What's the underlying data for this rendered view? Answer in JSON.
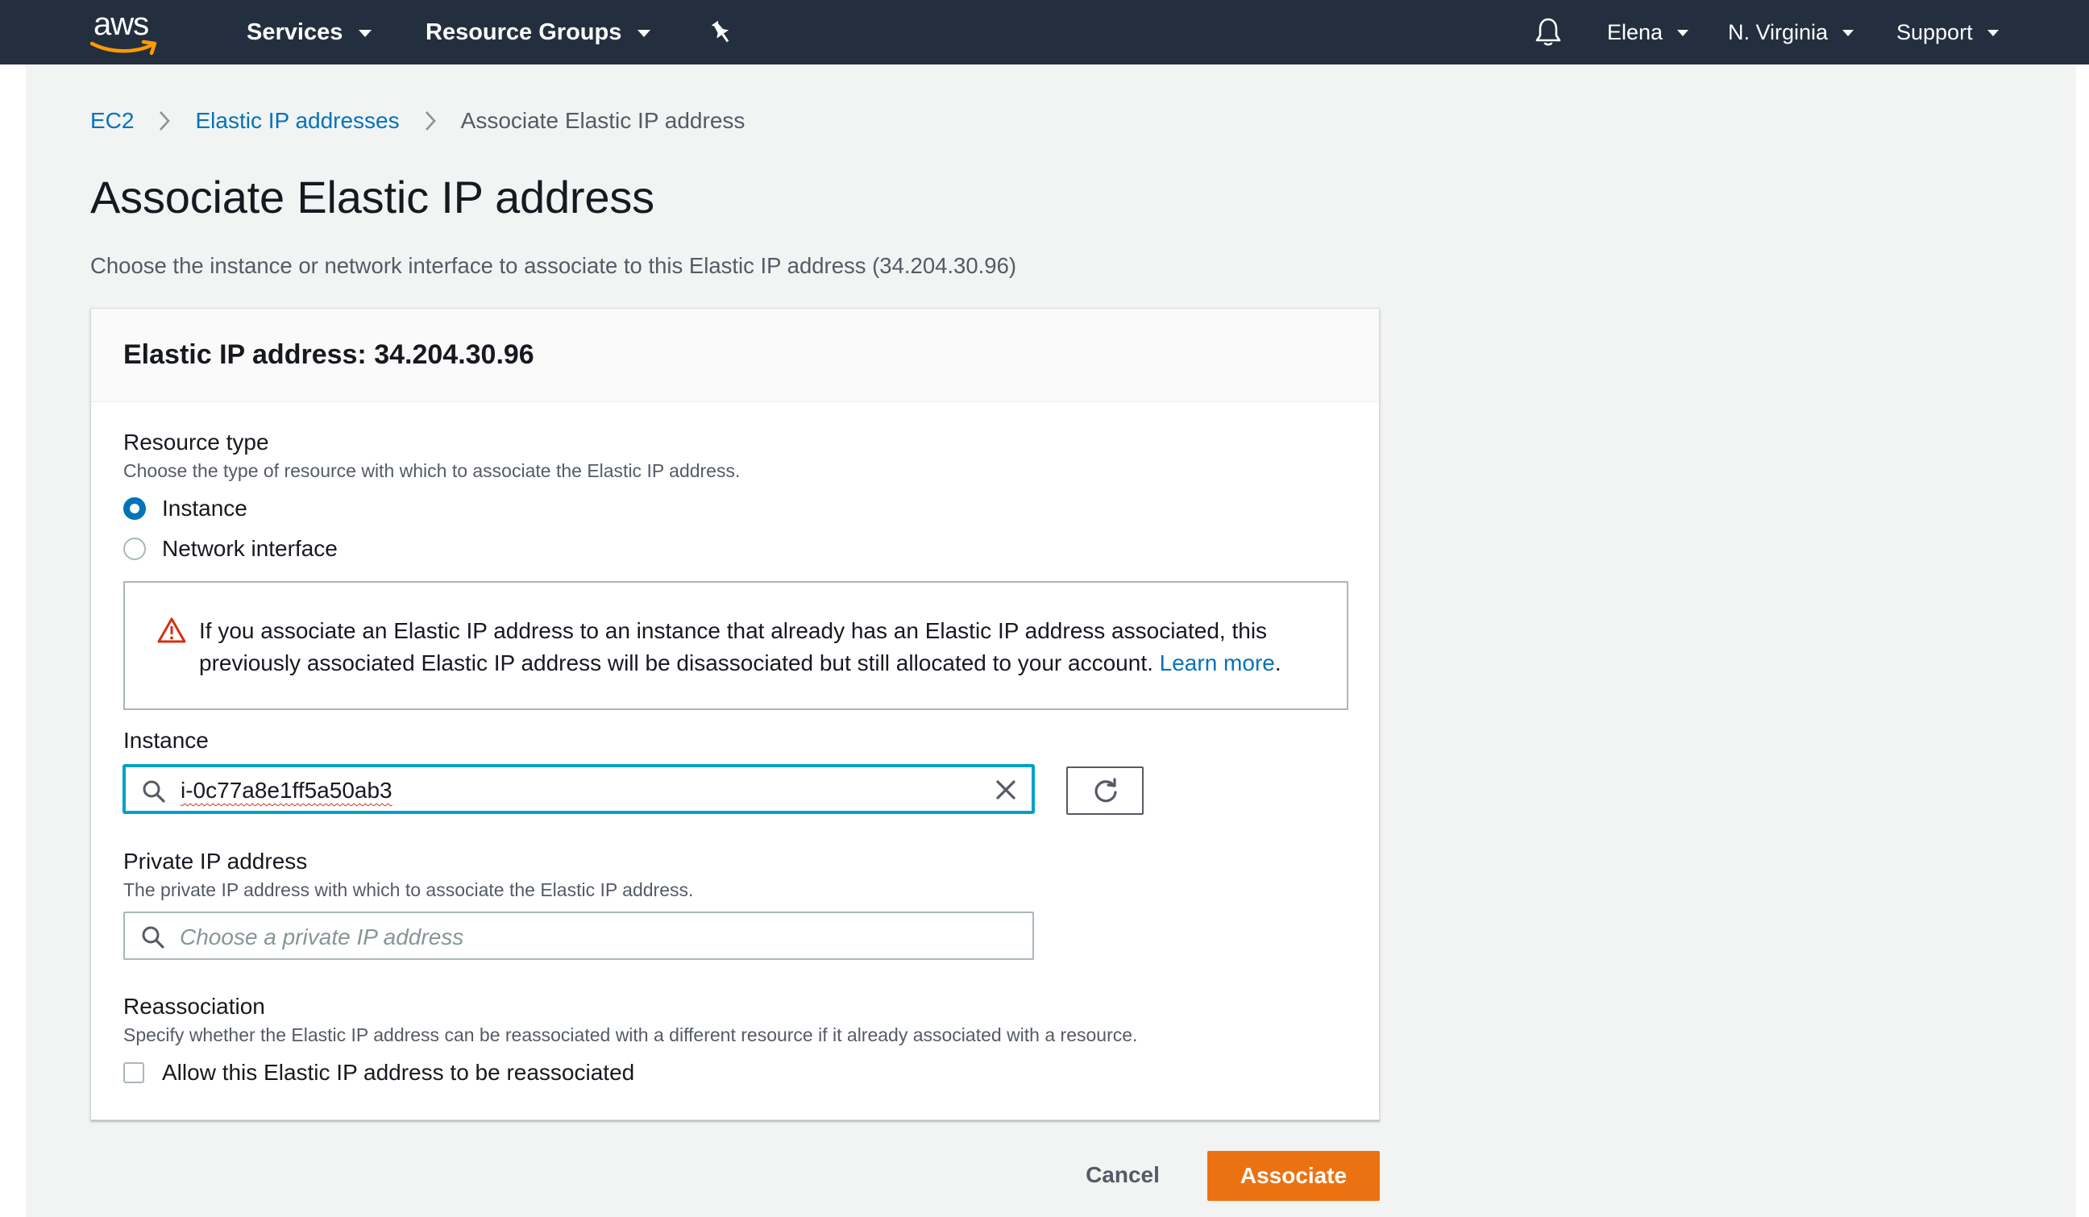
{
  "topnav": {
    "logo_text": "aws",
    "services_label": "Services",
    "resource_groups_label": "Resource Groups",
    "pin_icon": "pushpin-icon",
    "bell_icon": "bell-icon",
    "user_label": "Elena",
    "region_label": "N. Virginia",
    "support_label": "Support"
  },
  "breadcrumb": {
    "items": [
      "EC2",
      "Elastic IP addresses",
      "Associate Elastic IP address"
    ]
  },
  "page": {
    "title": "Associate Elastic IP address",
    "description": "Choose the instance or network interface to associate to this Elastic IP address (34.204.30.96)"
  },
  "panel": {
    "title": "Elastic IP address: 34.204.30.96",
    "resource_type": {
      "label": "Resource type",
      "description": "Choose the type of resource with which to associate the Elastic IP address.",
      "options": [
        {
          "label": "Instance",
          "selected": true
        },
        {
          "label": "Network interface",
          "selected": false
        }
      ]
    },
    "alert": {
      "icon": "warning-triangle-icon",
      "text": "If you associate an Elastic IP address to an instance that already has an Elastic IP address associated, this previously associated Elastic IP address will be disassociated but still allocated to your account.",
      "link_label": "Learn more",
      "trailing": "."
    },
    "instance": {
      "label": "Instance",
      "value": "i-0c77a8e1ff5a50ab3"
    },
    "private_ip": {
      "label": "Private IP address",
      "description": "The private IP address with which to associate the Elastic IP address.",
      "placeholder": "Choose a private IP address"
    },
    "reassociation": {
      "label": "Reassociation",
      "description": "Specify whether the Elastic IP address can be reassociated with a different resource if it already associated with a resource.",
      "checkbox_label": "Allow this Elastic IP address to be reassociated",
      "checked": false
    }
  },
  "actions": {
    "cancel_label": "Cancel",
    "associate_label": "Associate"
  },
  "colors": {
    "nav_bg": "#232f3e",
    "link": "#0073bb",
    "primary": "#ec7211",
    "focus": "#00a1c9",
    "warning": "#d13212"
  }
}
